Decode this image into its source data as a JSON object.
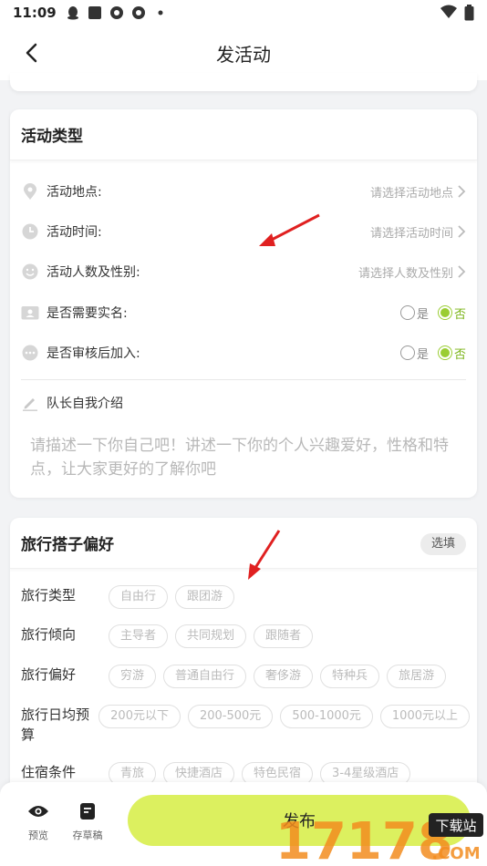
{
  "status_bar": {
    "time": "11:09"
  },
  "nav": {
    "title": "发活动"
  },
  "activity_card": {
    "title": "活动类型",
    "rows": [
      {
        "label": "活动地点:",
        "placeholder": "请选择活动地点"
      },
      {
        "label": "活动时间:",
        "placeholder": "请选择活动时间"
      },
      {
        "label": "活动人数及性别:",
        "placeholder": "请选择人数及性别"
      }
    ],
    "toggles": [
      {
        "label": "是否需要实名:",
        "yes": "是",
        "no": "否",
        "selected": "no"
      },
      {
        "label": "是否审核后加入:",
        "yes": "是",
        "no": "否",
        "selected": "no"
      }
    ],
    "intro_label": "队长自我介绍",
    "intro_placeholder": "请描述一下你自己吧！讲述一下你的个人兴趣爱好，性格和特点，让大家更好的了解你吧"
  },
  "pref_card": {
    "title": "旅行搭子偏好",
    "optional": "选填",
    "rows": [
      {
        "label": "旅行类型",
        "tags": [
          "自由行",
          "跟团游"
        ]
      },
      {
        "label": "旅行倾向",
        "tags": [
          "主导者",
          "共同规划",
          "跟随者"
        ]
      },
      {
        "label": "旅行偏好",
        "tags": [
          "穷游",
          "普通自由行",
          "奢侈游",
          "特种兵",
          "旅居游"
        ]
      },
      {
        "label": "旅行日均预算",
        "tags": [
          "200元以下",
          "200-500元",
          "500-1000元",
          "1000元以上"
        ]
      },
      {
        "label": "住宿条件",
        "tags": [
          "青旅",
          "快捷酒店",
          "特色民宿",
          "3-4星级酒店"
        ]
      }
    ]
  },
  "bottom_bar": {
    "preview": "预览",
    "draft": "存草稿",
    "publish": "发布"
  },
  "watermark": {
    "number": "17178",
    "site": "下载站",
    "tld": ".COM"
  },
  "colors": {
    "accent": "#9acd32",
    "publish_bg": "#dcf05f",
    "arrow": "#e02020"
  }
}
